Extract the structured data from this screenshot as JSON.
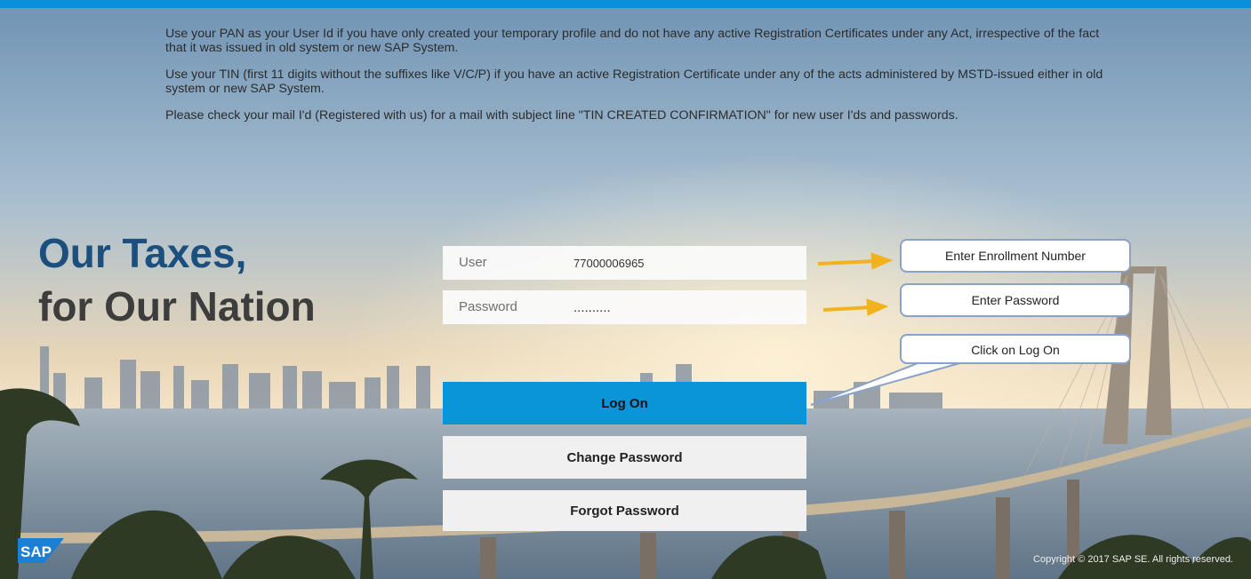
{
  "notices": [
    "Use your PAN as your User Id if you have only created your temporary profile and do not have any active Registration Certificates under any Act, irrespective of the fact that it was issued in old system or new SAP System.",
    "Use your TIN (first 11 digits without the suffixes like V/C/P) if you have an active Registration Certificate under any of the acts administered by MSTD-issued either in old system or new SAP System.",
    "Please check your mail I'd (Registered with us) for a mail with subject line \"TIN CREATED CONFIRMATION\" for new user I'ds and passwords."
  ],
  "tagline": {
    "line1": "Our Taxes,",
    "line2": "for Our Nation"
  },
  "form": {
    "user_label": "User",
    "user_value": "77000006965",
    "password_label": "Password",
    "password_value": "..........",
    "logon_label": "Log On",
    "change_password_label": "Change Password",
    "forgot_password_label": "Forgot Password"
  },
  "callouts": {
    "enrollment": "Enter Enrollment Number",
    "password": "Enter Password",
    "logon": "Click on Log On"
  },
  "logo_text": "SAP",
  "footer": {
    "copyright": "Copyright © 2017 SAP SE. All rights reserved."
  },
  "colors": {
    "accent": "#0a95d8",
    "topbar": "#0a8fd8",
    "tagline_blue": "#1a4f7e",
    "arrow": "#f2b21c"
  }
}
